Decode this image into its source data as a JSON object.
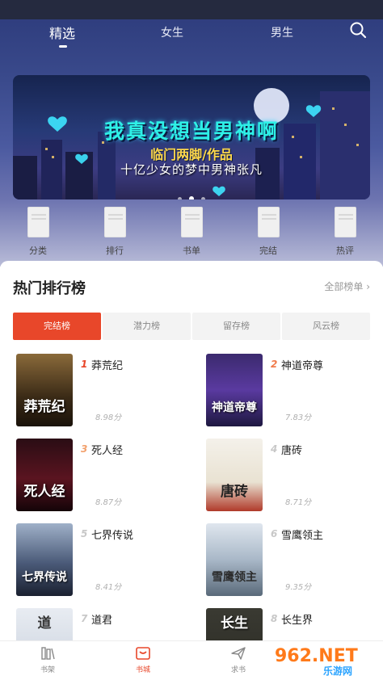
{
  "header": {
    "tabs": [
      {
        "label": "精选",
        "active": true
      },
      {
        "label": "女生",
        "active": false
      },
      {
        "label": "男生",
        "active": false
      }
    ],
    "search_icon": "search-icon"
  },
  "banner": {
    "title": "我真没想当男神啊",
    "author": "临门两脚/作品",
    "subtitle": "十亿少女的梦中男神张凡",
    "page_count": 3,
    "current_page": 1
  },
  "quick_nav": [
    {
      "label": "分类"
    },
    {
      "label": "排行"
    },
    {
      "label": "书单"
    },
    {
      "label": "完结"
    },
    {
      "label": "热评"
    }
  ],
  "ranking": {
    "title": "热门排行榜",
    "more": "全部榜单 ›",
    "tabs": [
      {
        "label": "完结榜",
        "active": true
      },
      {
        "label": "潜力榜",
        "active": false
      },
      {
        "label": "留存榜",
        "active": false
      },
      {
        "label": "风云榜",
        "active": false
      }
    ],
    "books": [
      {
        "rank": "1",
        "name": "莽荒纪",
        "score": "8.98分",
        "cover_text": "莽荒纪"
      },
      {
        "rank": "2",
        "name": "神道帝尊",
        "score": "7.83分",
        "cover_text": "神道帝尊"
      },
      {
        "rank": "3",
        "name": "死人经",
        "score": "8.87分",
        "cover_text": "死人经"
      },
      {
        "rank": "4",
        "name": "唐砖",
        "score": "8.71分",
        "cover_text": "唐砖"
      },
      {
        "rank": "5",
        "name": "七界传说",
        "score": "8.41分",
        "cover_text": "七界传说"
      },
      {
        "rank": "6",
        "name": "雪鹰领主",
        "score": "9.35分",
        "cover_text": "雪鹰领主"
      },
      {
        "rank": "7",
        "name": "道君",
        "score": "",
        "cover_text": "道"
      },
      {
        "rank": "8",
        "name": "长生界",
        "score": "",
        "cover_text": "长生"
      }
    ],
    "rank_colors": {
      "top": "#e8472a",
      "second": "#f07a4a",
      "third": "#f2a06c",
      "normal": "#c8c8c8"
    }
  },
  "bottom_nav": [
    {
      "label": "书架",
      "icon": "bookshelf-icon",
      "active": false
    },
    {
      "label": "书城",
      "icon": "bookstore-icon",
      "active": true
    },
    {
      "label": "求书",
      "icon": "send-icon",
      "active": false
    }
  ],
  "watermark": {
    "main": "962.NET",
    "sub": "乐游网"
  },
  "colors": {
    "accent": "#e8472a",
    "header_bg": "#3a4a8c"
  }
}
